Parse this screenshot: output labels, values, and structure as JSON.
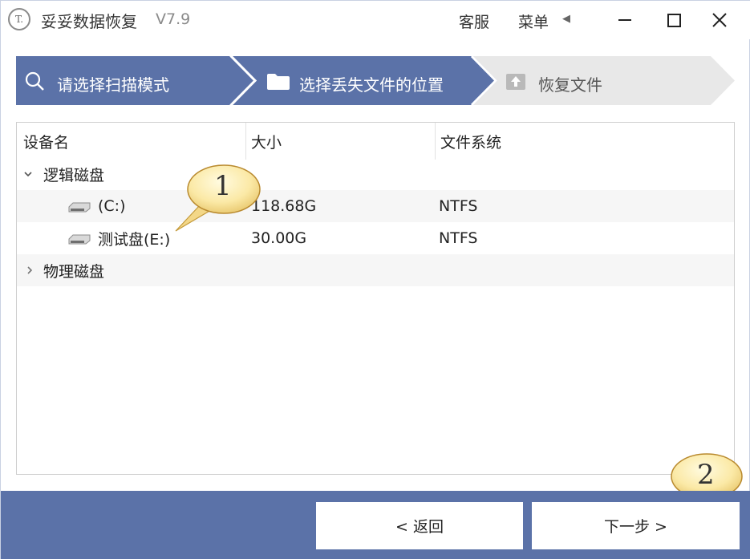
{
  "app": {
    "logo_text": "T.",
    "title": "妥妥数据恢复",
    "version": "V7.9"
  },
  "titlebar": {
    "service": "客服",
    "menu": "菜单",
    "menu_arrow": "◀"
  },
  "steps": [
    {
      "label": "请选择扫描模式",
      "icon": "search-icon",
      "state": "done"
    },
    {
      "label": "选择丢失文件的位置",
      "icon": "folder-icon",
      "state": "active"
    },
    {
      "label": "恢复文件",
      "icon": "recover-icon",
      "state": "pending"
    }
  ],
  "colors": {
    "step_active": "#5b72a8",
    "step_pending": "#e8e8e8",
    "footer": "#5b72a8"
  },
  "table": {
    "headers": [
      "设备名",
      "大小",
      "文件系统"
    ],
    "groups": [
      {
        "label": "逻辑磁盘",
        "expanded": true,
        "chevron": "⌄",
        "items": [
          {
            "name": "(C:)",
            "size": "118.68G",
            "fs": "NTFS",
            "icon": "drive-icon"
          },
          {
            "name": "测试盘(E:)",
            "size": "30.00G",
            "fs": "NTFS",
            "icon": "drive-icon"
          }
        ]
      },
      {
        "label": "物理磁盘",
        "expanded": false,
        "chevron": "›",
        "items": []
      }
    ]
  },
  "callouts": [
    {
      "number": "1"
    },
    {
      "number": "2"
    }
  ],
  "footer": {
    "back_label": "< 返回",
    "next_label": "下一步 >"
  }
}
